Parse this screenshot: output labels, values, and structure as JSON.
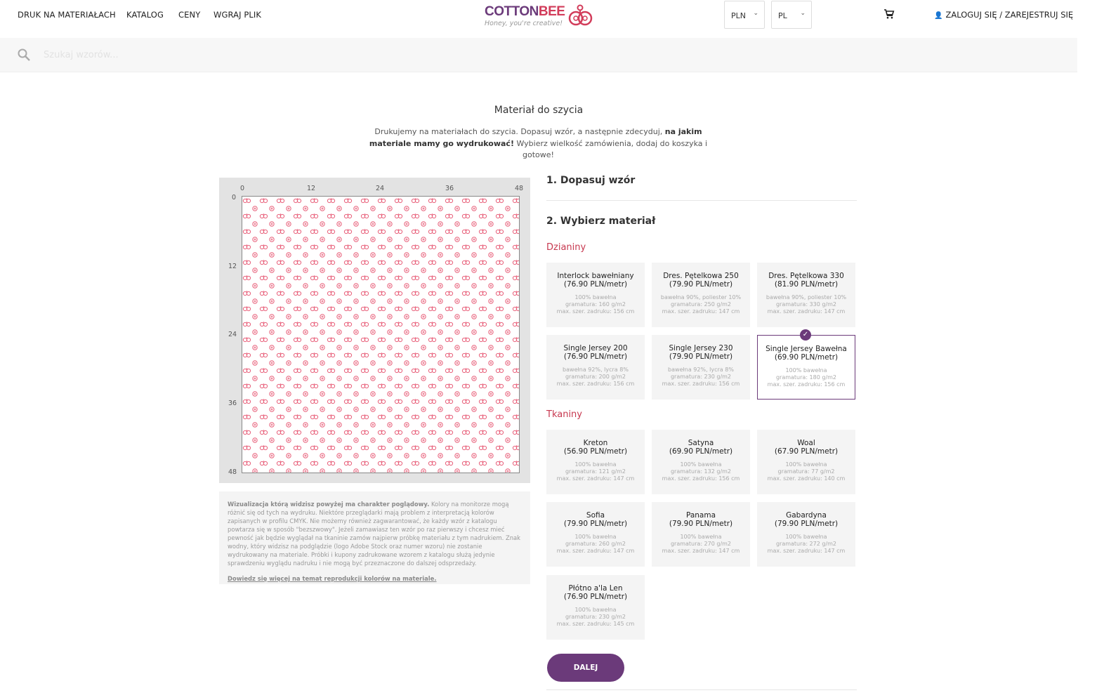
{
  "nav": {
    "items": [
      "DRUK NA MATERIAŁACH",
      "KATALOG",
      "CENY",
      "WGRAJ PLIK"
    ]
  },
  "logo": {
    "word_main": "COTTON",
    "word_accent": "BEE",
    "tagline": "Honey, you're creative!"
  },
  "currency": {
    "value": "PLN"
  },
  "language": {
    "value": "PL"
  },
  "account": {
    "label": "ZALOGUJ SIĘ / ZAREJESTRUJ SIĘ"
  },
  "search": {
    "placeholder": "Szukaj wzorów..."
  },
  "page": {
    "title": "Materiał do szycia",
    "intro_1": "Drukujemy na materiałach do szycia. Dopasuj wzór, a następnie zdecyduj, ",
    "intro_bold": "na jakim materiale mamy go wydrukować!",
    "intro_2": " Wybierz wielkość zamówienia, dodaj do koszyka i gotowe!"
  },
  "preview": {
    "ruler_top": [
      "0",
      "12",
      "24",
      "36",
      "48"
    ],
    "ruler_left": [
      "0",
      "12",
      "24",
      "36",
      "48"
    ],
    "pattern_color": "#e8607a"
  },
  "disclaimer": {
    "bold": "Wizualizacja którą widzisz powyżej ma charakter poglądowy.",
    "text": " Kolory na monitorze mogą różnić się od tych na wydruku. Niektóre przeglądarki mają problem z interpretacją kolorów zapisanych w profilu CMYK. Nie możemy również zagwarantować, że każdy wzór z katalogu powtarza się w sposób \"bezszwowy\". Jeżeli zamawiasz ten wzór po raz pierwszy i chcesz mieć pewność jak będzie wyglądał na tkaninie zamów najpierw próbkę materiału z tym nadrukiem. Znak wodny, który widzisz na podglądzie (logo Adobe Stock oraz numer wzoru) nie zostanie wydrukowany na materiale. Próbki i kupony zadrukowane wzorem z katalogu służą jedynie sprawdzeniu wyglądu nadruku i nie mogą być przeznaczone do dalszej odsprzedaży.",
    "link": "Dowiedz się więcej na temat reprodukcji kolorów na materiale."
  },
  "steps": {
    "step1": "1. Dopasuj wzór",
    "step2": "2. Wybierz materiał"
  },
  "groups": {
    "knit": "Dzianiny",
    "woven": "Tkaniny"
  },
  "materials": [
    {
      "name": "Interlock bawełniany",
      "price": "(76.90 PLN/metr)",
      "composition": "100% bawełna",
      "weight": "gramatura: 160 g/m2",
      "width": "max. szer. zadruku: 156 cm",
      "selected": false
    },
    {
      "name": "Dres. Pętelkowa 250",
      "price": "(79.90 PLN/metr)",
      "composition": "bawełna 90%, poliester 10%",
      "weight": "gramatura: 250 g/m2",
      "width": "max. szer. zadruku: 147 cm",
      "selected": false
    },
    {
      "name": "Dres. Pętelkowa 330",
      "price": "(81.90 PLN/metr)",
      "composition": "bawełna 90%, poliester 10%",
      "weight": "gramatura: 330 g/m2",
      "width": "max. szer. zadruku: 147 cm",
      "selected": false
    },
    {
      "name": "Single Jersey 200",
      "price": "(76.90 PLN/metr)",
      "composition": "bawełna 92%, lycra 8%",
      "weight": "gramatura: 200 g/m2",
      "width": "max. szer. zadruku: 156 cm",
      "selected": false
    },
    {
      "name": "Single Jersey 230",
      "price": "(79.90 PLN/metr)",
      "composition": "bawełna 92%, lycra 8%",
      "weight": "gramatura: 230 g/m2",
      "width": "max. szer. zadruku: 156 cm",
      "selected": false
    },
    {
      "name": "Single Jersey Bawełna",
      "price": "(69.90 PLN/metr)",
      "composition": "100% bawełna",
      "weight": "gramatura: 180 g/m2",
      "width": "max. szer. zadruku: 156 cm",
      "selected": true
    },
    {
      "name": "Kreton",
      "price": "(56.90 PLN/metr)",
      "composition": "100% bawełna",
      "weight": "gramatura: 121 g/m2",
      "width": "max. szer. zadruku: 147 cm",
      "selected": false
    },
    {
      "name": "Satyna",
      "price": "(69.90 PLN/metr)",
      "composition": "100% bawełna",
      "weight": "gramatura: 132 g/m2",
      "width": "max. szer. zadruku: 156 cm",
      "selected": false
    },
    {
      "name": "Woal",
      "price": "(67.90 PLN/metr)",
      "composition": "100% bawełna",
      "weight": "gramatura: 77 g/m2",
      "width": "max. szer. zadruku: 140 cm",
      "selected": false
    },
    {
      "name": "Sofia",
      "price": "(79.90 PLN/metr)",
      "composition": "100% bawełna",
      "weight": "gramatura: 260 g/m2",
      "width": "max. szer. zadruku: 147 cm",
      "selected": false
    },
    {
      "name": "Panama",
      "price": "(79.90 PLN/metr)",
      "composition": "100% bawełna",
      "weight": "gramatura: 270 g/m2",
      "width": "max. szer. zadruku: 147 cm",
      "selected": false
    },
    {
      "name": "Gabardyna",
      "price": "(79.90 PLN/metr)",
      "composition": "100% bawełna",
      "weight": "gramatura: 272 g/m2",
      "width": "max. szer. zadruku: 147 cm",
      "selected": false
    },
    {
      "name": "Płótno a'la Len",
      "price": "(76.90 PLN/metr)",
      "composition": "100% bawełna",
      "weight": "gramatura: 230 g/m2",
      "width": "max. szer. zadruku: 145 cm",
      "selected": false
    }
  ],
  "next_button": "DALEJ",
  "colors": {
    "brand_purple": "#6b3a7a",
    "accent_red": "#c7384f"
  }
}
